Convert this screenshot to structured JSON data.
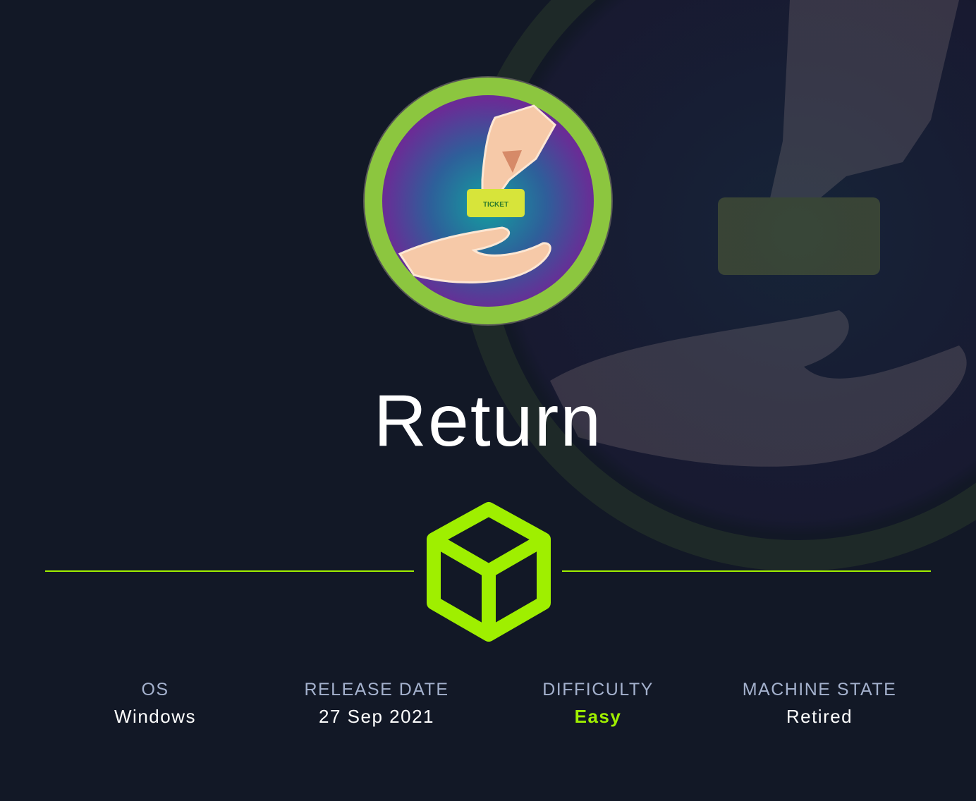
{
  "machine": {
    "name": "Return",
    "avatar_icon": "ticket-handoff-logo",
    "avatar_ticket_text": "TICKET"
  },
  "divider_icon": "cube-icon",
  "info": {
    "os": {
      "label": "OS",
      "value": "Windows"
    },
    "release_date": {
      "label": "RELEASE DATE",
      "value": "27 Sep 2021"
    },
    "difficulty": {
      "label": "DIFFICULTY",
      "value": "Easy"
    },
    "machine_state": {
      "label": "MACHINE STATE",
      "value": "Retired"
    }
  },
  "colors": {
    "background": "#121826",
    "accent": "#9fef00",
    "label": "#a4b1cd"
  }
}
